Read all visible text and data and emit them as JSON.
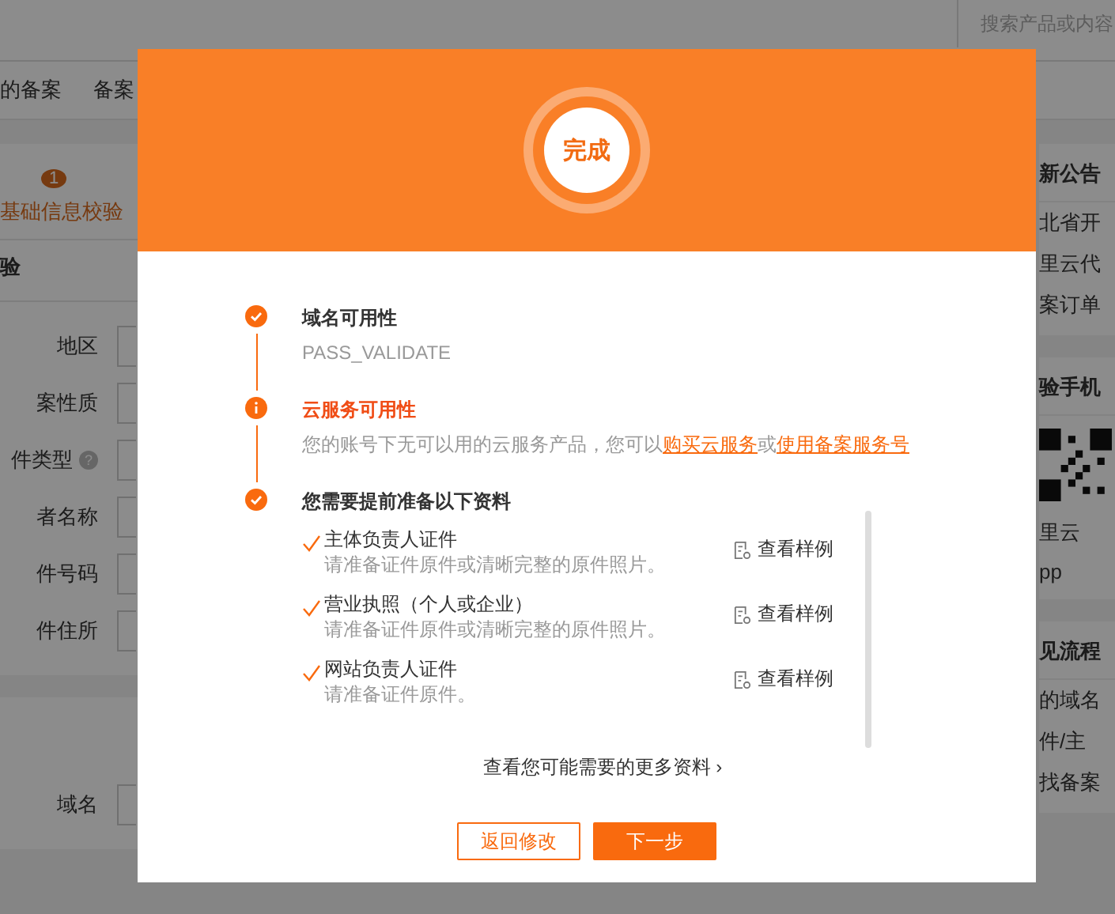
{
  "header": {
    "search": {
      "placeholder": "搜索产品或内容"
    }
  },
  "nav": [
    {
      "label": "的备案"
    },
    {
      "label": "备案"
    }
  ],
  "steps": [
    {
      "number": "1",
      "label": "基础信息校验"
    }
  ],
  "form_section": {
    "title": "验",
    "fields": [
      {
        "label": "地区"
      },
      {
        "label": "案性质"
      },
      {
        "label": "件类型",
        "help": "?"
      },
      {
        "label": "者名称"
      },
      {
        "label": "件号码"
      },
      {
        "label": "件住所"
      }
    ]
  },
  "domain_section": {
    "fields": [
      {
        "label": "域名"
      }
    ]
  },
  "sidebar": [
    {
      "title": "新公告",
      "items": [
        "北省开",
        "里云代",
        "案订单"
      ]
    },
    {
      "title": "验手机",
      "app_lines": [
        "里云",
        "pp"
      ]
    },
    {
      "title": "见流程",
      "items": [
        "的域名",
        "件/主",
        "找备案"
      ]
    }
  ],
  "dialog": {
    "badge": "完成",
    "checks": [
      {
        "kind": "success",
        "title": "域名可用性",
        "detail": [
          {
            "kind": "text",
            "text": "PASS_VALIDATE"
          }
        ]
      },
      {
        "kind": "warning",
        "title": "云服务可用性",
        "detail": [
          {
            "kind": "text",
            "text": "您的账号下无可以用的云服务产品，您可以"
          },
          {
            "kind": "link",
            "text": "购买云服务"
          },
          {
            "kind": "text",
            "text": "或"
          },
          {
            "kind": "link",
            "text": "使用备案服务号"
          }
        ]
      },
      {
        "kind": "success",
        "title": "您需要提前准备以下资料"
      }
    ],
    "materials": [
      {
        "name": "主体负责人证件",
        "note": "请准备证件原件或清晰完整的原件照片。",
        "sample": "查看样例"
      },
      {
        "name": "营业执照（个人或企业）",
        "note": "请准备证件原件或清晰完整的原件照片。",
        "sample": "查看样例"
      },
      {
        "name": "网站负责人证件",
        "note": "请准备证件原件。",
        "sample": "查看样例"
      }
    ],
    "more": {
      "label": "查看您可能需要的更多资料",
      "arrow": "›"
    },
    "buttons": [
      {
        "kind": "secondary",
        "label": "返回修改"
      },
      {
        "kind": "primary",
        "label": "下一步"
      }
    ]
  }
}
